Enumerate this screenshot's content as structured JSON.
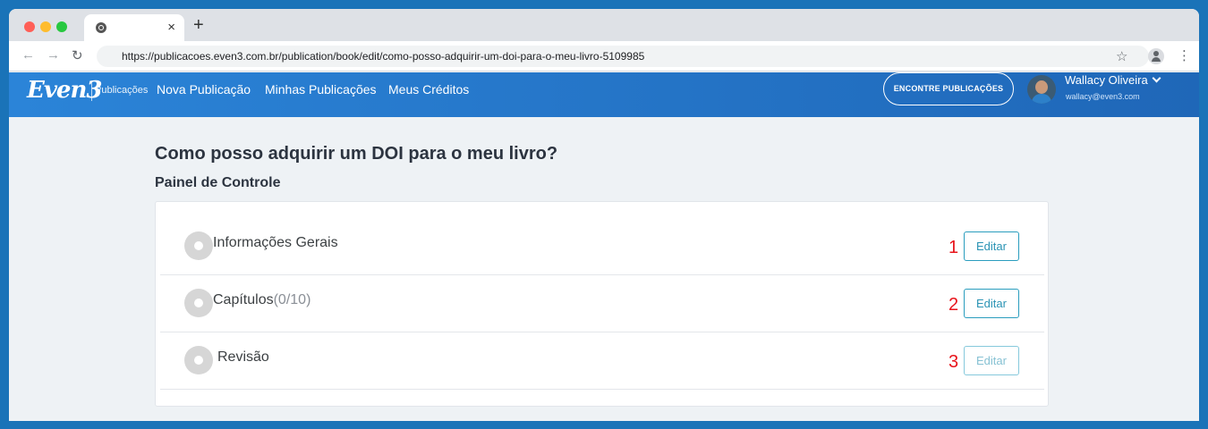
{
  "browser": {
    "url": "https://publicacoes.even3.com.br/publication/book/edit/como-posso-adquirir-um-doi-para-o-meu-livro-5109985",
    "tab_close": "×",
    "new_tab": "+",
    "back": "←",
    "forward": "→",
    "reload": "C",
    "star": "☆",
    "menu": "⋮"
  },
  "header": {
    "logo": "Even3",
    "logo_sub": "Publicações",
    "nav": [
      "Nova Publicação",
      "Minhas Publicações",
      "Meus Créditos"
    ],
    "find_button": "ENCONTRE PUBLICAÇÕES",
    "user_name": "Wallacy Oliveira",
    "user_email": "wallacy@even3.com",
    "brand_color": "#2b84d8"
  },
  "main": {
    "title": "Como posso adquirir um DOI para o meu livro?",
    "section_title": "Painel de Controle",
    "steps": [
      {
        "label": "Informações Gerais",
        "count": "",
        "number": "1",
        "button": "Editar",
        "enabled": true
      },
      {
        "label": "Capítulos",
        "count": "(0/10)",
        "number": "2",
        "button": "Editar",
        "enabled": true
      },
      {
        "label": "Revisão",
        "count": "",
        "number": "3",
        "button": "Editar",
        "enabled": false
      }
    ]
  }
}
